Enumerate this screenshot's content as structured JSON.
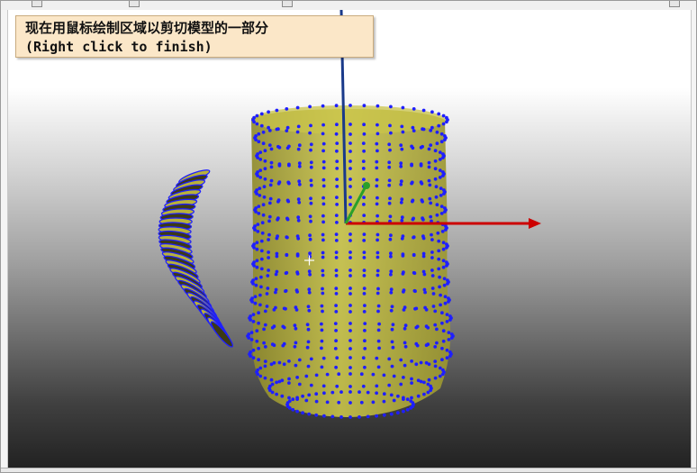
{
  "hint": {
    "line1": "现在用鼠标绘制区域以剪切模型的一部分",
    "line2": "(Right click to finish)"
  },
  "scene": {
    "model": "mug",
    "background_top": "#ffffff",
    "background_bottom": "#222222",
    "mesh_fill": "#b8b23a",
    "point_color": "#1f1fff",
    "axis_x_color": "#cc0000",
    "axis_y_color": "#1a3a8a",
    "axis_z_color": "#2aa02a",
    "cursor_icon": "crosshair-icon"
  }
}
